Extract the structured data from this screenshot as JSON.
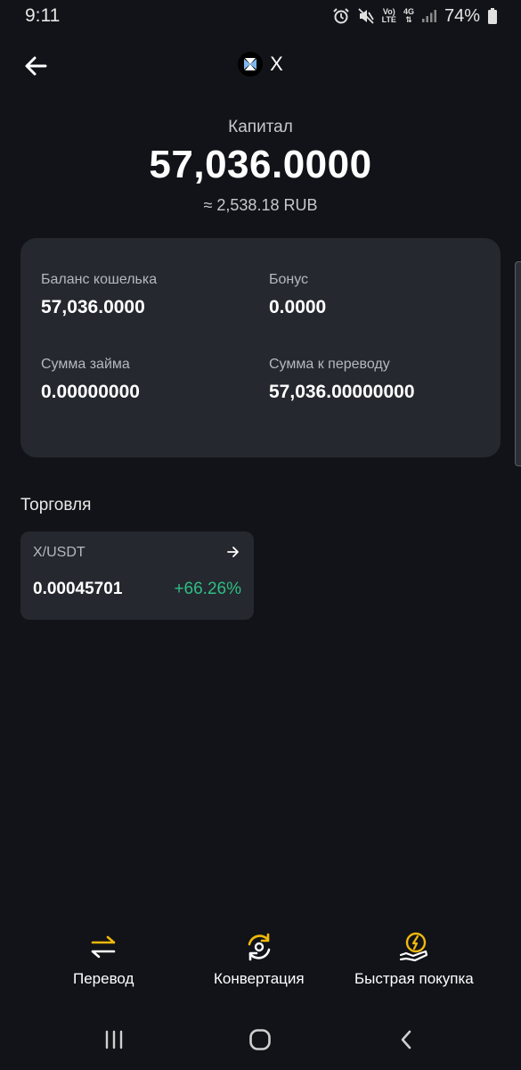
{
  "status_bar": {
    "time": "9:11",
    "volte_top": "Vo)",
    "volte_bottom": "LTE",
    "network_type": "4G",
    "battery_percent": "74%",
    "icons": [
      "alarm-icon",
      "mute-icon",
      "volte-icon",
      "network-4g-icon",
      "signal-icon",
      "battery-icon"
    ]
  },
  "header": {
    "back_icon": "arrow-left-icon",
    "coin_logo_icon": "x-coin-logo-icon",
    "coin_name": "X"
  },
  "capital": {
    "label": "Капитал",
    "value": "57,036.0000",
    "fiat_value": "≈ 2,538.18 RUB"
  },
  "balances": {
    "wallet_balance": {
      "label": "Баланс кошелька",
      "value": "57,036.0000"
    },
    "bonus": {
      "label": "Бонус",
      "value": "0.0000"
    },
    "loan_amount": {
      "label": "Сумма займа",
      "value": "0.00000000"
    },
    "transferable": {
      "label": "Сумма к переводу",
      "value": "57,036.00000000"
    }
  },
  "trading": {
    "title": "Торговля",
    "pairs": [
      {
        "pair": "X/USDT",
        "price": "0.00045701",
        "change": "+66.26%",
        "change_color": "#2ebd85"
      }
    ]
  },
  "actions": [
    {
      "label": "Перевод",
      "icon": "transfer-icon"
    },
    {
      "label": "Конвертация",
      "icon": "convert-icon"
    },
    {
      "label": "Быстрая покупка",
      "icon": "quick-buy-icon"
    }
  ],
  "system_nav": [
    "recent-apps-icon",
    "home-icon",
    "back-icon"
  ],
  "colors": {
    "background": "#121318",
    "card": "#25282e",
    "accent": "#f0b90b",
    "positive": "#2ebd85"
  }
}
